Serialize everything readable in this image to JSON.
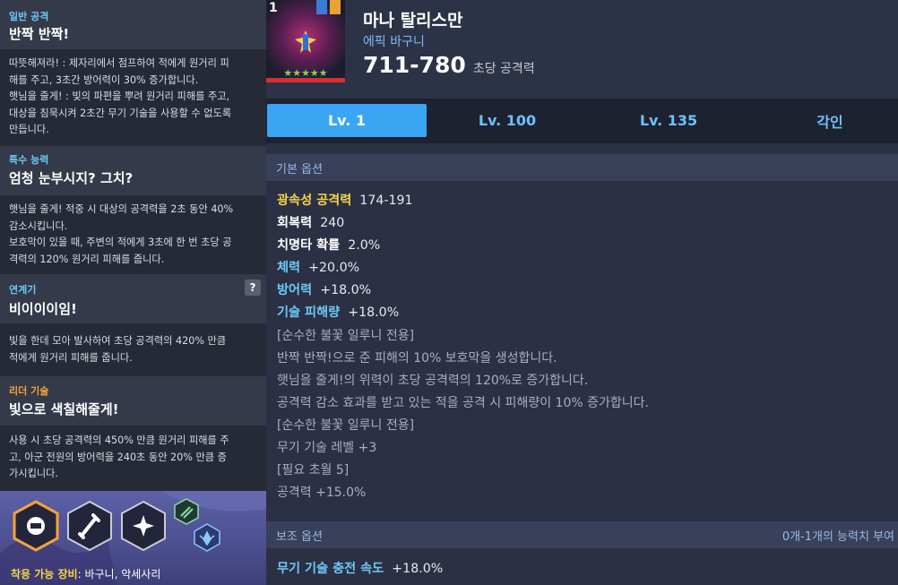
{
  "colors": {
    "accent": "#3aa6f3",
    "yellow_label": "#f3d54a",
    "cyan_label": "#6ec8f5",
    "orange_tag": "#f4a23c"
  },
  "left": {
    "s1": {
      "tag": "일반 공격",
      "title": "반짝 반짝!",
      "lines": [
        "따뜻해져라! : 제자리에서 점프하여 적에게 원거리 피",
        "해를 주고, 3초간 방어력이 30% 증가합니다.",
        "햇님을 줄게! : 빛의 파편을 뿌려 원거리 피해를 주고,",
        "대상을 침묵시켜 2초간 무기 기술을 사용할 수 없도록",
        "만듭니다."
      ]
    },
    "s2": {
      "tag": "특수 능력",
      "title": "엄청 눈부시지? 그치?",
      "lines": [
        "햇님을 줄게! 적중 시 대상의 공격력을 2초 동안 40%",
        "감소시킵니다.",
        "보호막이 있을 때, 주변의 적에게 3초에 한 번 초당 공",
        "격력의 120% 원거리 피해를 줍니다."
      ]
    },
    "s3": {
      "tag": "연계기",
      "title": "비이이이임!",
      "help": "?",
      "lines": [
        "빛을 한데 모아 발사하여 초당 공격력의 420% 만큼",
        "적에게 원거리 피해를 줍니다."
      ]
    },
    "s4": {
      "tag": "리더 기술",
      "title": "빛으로 색칠해줄게!",
      "lines": [
        "사용 시 초당 공격력의 450% 만큼 원거리 피해를 주",
        "고, 아군 전원의 방어력을 240초 동안 20% 만큼 증",
        "가시킵니다."
      ]
    },
    "icons": [
      "leader-skill-icon",
      "sword-skill-icon",
      "sparkle-skill-icon",
      "chain-skill-icon",
      "wing-skill-icon"
    ],
    "equip_label": "착용 가능 장비",
    "equip_value": ": 바구니, 악세사리"
  },
  "item": {
    "badge": "1",
    "name": "마나 탈리스만",
    "type": "에픽 바구니",
    "dps": "711-780",
    "dps_label": "초당 공격력",
    "stars": "★★★★★"
  },
  "tabs": [
    {
      "label": "Lv. 1"
    },
    {
      "label": "Lv. 100"
    },
    {
      "label": "Lv. 135"
    },
    {
      "label": "각인"
    }
  ],
  "basic": {
    "title": "기본 옵션",
    "stats": [
      {
        "k": "광속성 공격력",
        "v": "174-191",
        "color": "yellow"
      },
      {
        "k": "회복력",
        "v": "240",
        "color": "white"
      },
      {
        "k": "치명타 확률",
        "v": "2.0%",
        "color": "white"
      },
      {
        "k": "체력",
        "v": "+20.0%",
        "color": "cyan"
      },
      {
        "k": "방어력",
        "v": "+18.0%",
        "color": "cyan"
      },
      {
        "k": "기술 피해량",
        "v": "+18.0%",
        "color": "cyan"
      }
    ],
    "desc": [
      "[순수한 불꽃 일루니 전용]",
      "반짝 반짝!으로 준 피해의 10% 보호막을 생성합니다.",
      "햇님을 줄게!의 위력이 초당 공격력의 120%로 증가합니다.",
      "공격력 감소 효과를 받고 있는 적을 공격 시 피해량이 10% 증가합니다.",
      "[순수한 불꽃 일루니 전용]",
      "무기 기술 레벨 +3",
      "[필요 초월 5]",
      "공격력 +15.0%"
    ]
  },
  "sub": {
    "title": "보조 옵션",
    "right": "0개-1개의 능력치 부여",
    "stats": [
      {
        "k": "무기 기술 충전 속도",
        "v": "+18.0%",
        "color": "cyan"
      }
    ]
  }
}
